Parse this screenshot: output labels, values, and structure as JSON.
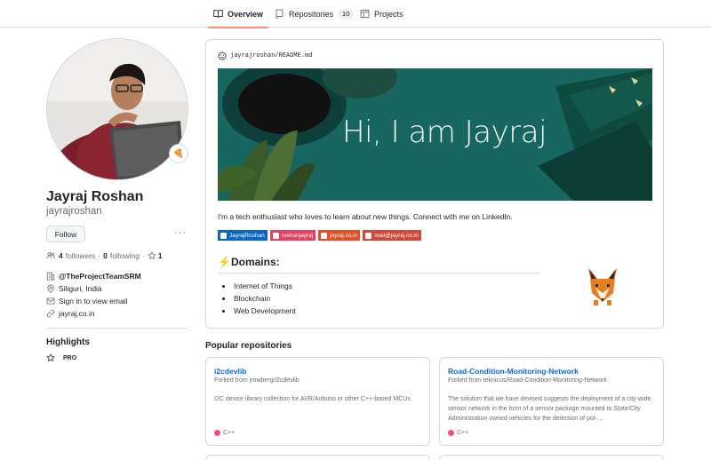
{
  "tabs": [
    {
      "label": "Overview",
      "icon": "book-icon"
    },
    {
      "label": "Repositories",
      "icon": "repo-icon",
      "count": "10"
    },
    {
      "label": "Projects",
      "icon": "table-icon"
    }
  ],
  "profile": {
    "name": "Jayraj Roshan",
    "login": "jayrajroshan",
    "status_emoji": "🍕",
    "follow_label": "Follow",
    "more_label": "···",
    "followers_count": "4",
    "followers_label": "followers",
    "following_count": "0",
    "following_label": "following",
    "stars_count": "1",
    "organization": "@TheProjectTeamSRM",
    "location": "Siliguri, India",
    "email": "Sign in to view email",
    "website": "jayraj.co.in"
  },
  "highlights": {
    "title": "Highlights",
    "pro_label": "PRO"
  },
  "readme": {
    "path_user": "jayrajroshan",
    "path_sep": "/",
    "path_file": "README.md",
    "banner_text": "Hi, I am Jayraj",
    "bio": "I'm a tech enthusiast who loves to learn about new things. Connect with me on LinkedIn.",
    "badges": [
      {
        "label": "JayrajRoshan",
        "color": "#0a66c2"
      },
      {
        "label": "roshanjayraj",
        "color": "#e4405f"
      },
      {
        "label": "jayraj.co.in",
        "color": "#e34f26"
      },
      {
        "label": "mail@jayraj.co.in",
        "color": "#d14836"
      }
    ],
    "domains_title": "⚡Domains:",
    "domains": [
      "Internet of Things",
      "Blockchain",
      "Web Development"
    ]
  },
  "popular": {
    "title": "Popular repositories",
    "repos": [
      {
        "name": "i2cdevlib",
        "fork": "Forked from jrowberg/i2cdevlib",
        "desc": "I2C device library collection for AVR/Arduino or other C++-based MCUs",
        "lang": "C++",
        "lang_color": "#f34b7d"
      },
      {
        "name": "Road-Condition-Monitoring-Network",
        "fork": "Forked from teknicus/Road-Condition-Monitoring-Network",
        "desc": "The solution that we have devised suggests the deployment of a city-wide sensor network in the form of a sensor package mounted to State/City Administration owned vehicles for the detection of pot-…",
        "lang": "C++",
        "lang_color": "#f34b7d"
      }
    ]
  }
}
